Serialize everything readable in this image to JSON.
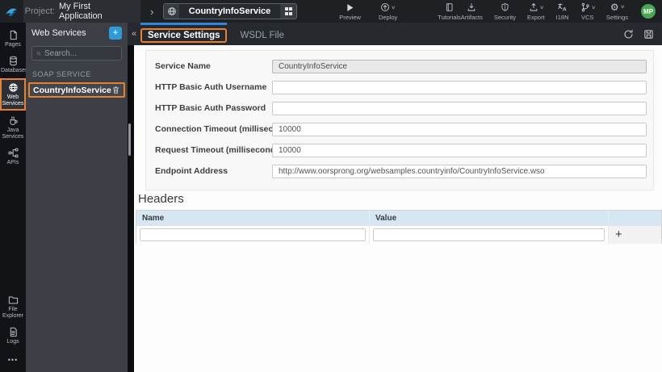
{
  "topbar": {
    "project_label": "Project:",
    "project_name": "My First Application",
    "service_chip": "CountryInfoService",
    "preview": "Preview",
    "deploy": "Deploy",
    "tutorials": "Tutorials",
    "artifacts": "Artifacts",
    "security": "Security",
    "export": "Export",
    "i18n": "I18N",
    "vcs": "VCS",
    "settings": "Settings",
    "avatar_initials": "MP"
  },
  "rail": {
    "pages": "Pages",
    "databases": "Databases",
    "web_services": "Web Services",
    "java_services": "Java Services",
    "apis": "APIs",
    "file_explorer": "File Explorer",
    "logs": "Logs"
  },
  "panel": {
    "title": "Web Services",
    "search_placeholder": "Search...",
    "section_label": "SOAP SERVICE",
    "service_name": "CountryInfoService"
  },
  "tabs": {
    "service_settings": "Service Settings",
    "wsdl_file": "WSDL File"
  },
  "form": {
    "fields": [
      {
        "label": "Service Name",
        "value": "CountryInfoService",
        "disabled": true
      },
      {
        "label": "HTTP Basic Auth Username",
        "value": ""
      },
      {
        "label": "HTTP Basic Auth Password",
        "value": ""
      },
      {
        "label": "Connection Timeout (milliseconds)",
        "value": "10000"
      },
      {
        "label": "Request Timeout (milliseconds)",
        "value": "10000"
      },
      {
        "label": "Endpoint Address",
        "value": "http://www.oorsprong.org/websamples.countryinfo/CountryInfoService.wso"
      }
    ]
  },
  "headers": {
    "title": "Headers",
    "columns": [
      "Name",
      "Value"
    ],
    "row": {
      "name": "",
      "value": ""
    },
    "add_label": "+"
  },
  "icons": {
    "plus": "+",
    "collapse": "«",
    "chevron_right": "›",
    "caret_down": "∨",
    "ellipsis": "•••",
    "gear": "⚙"
  },
  "colors": {
    "highlight_orange": "#e7812f",
    "active_tab_blue": "#2e86de",
    "add_button_blue": "#2b9cd8",
    "avatar_green": "#48a952",
    "table_header_blue": "#d6e7f4"
  }
}
